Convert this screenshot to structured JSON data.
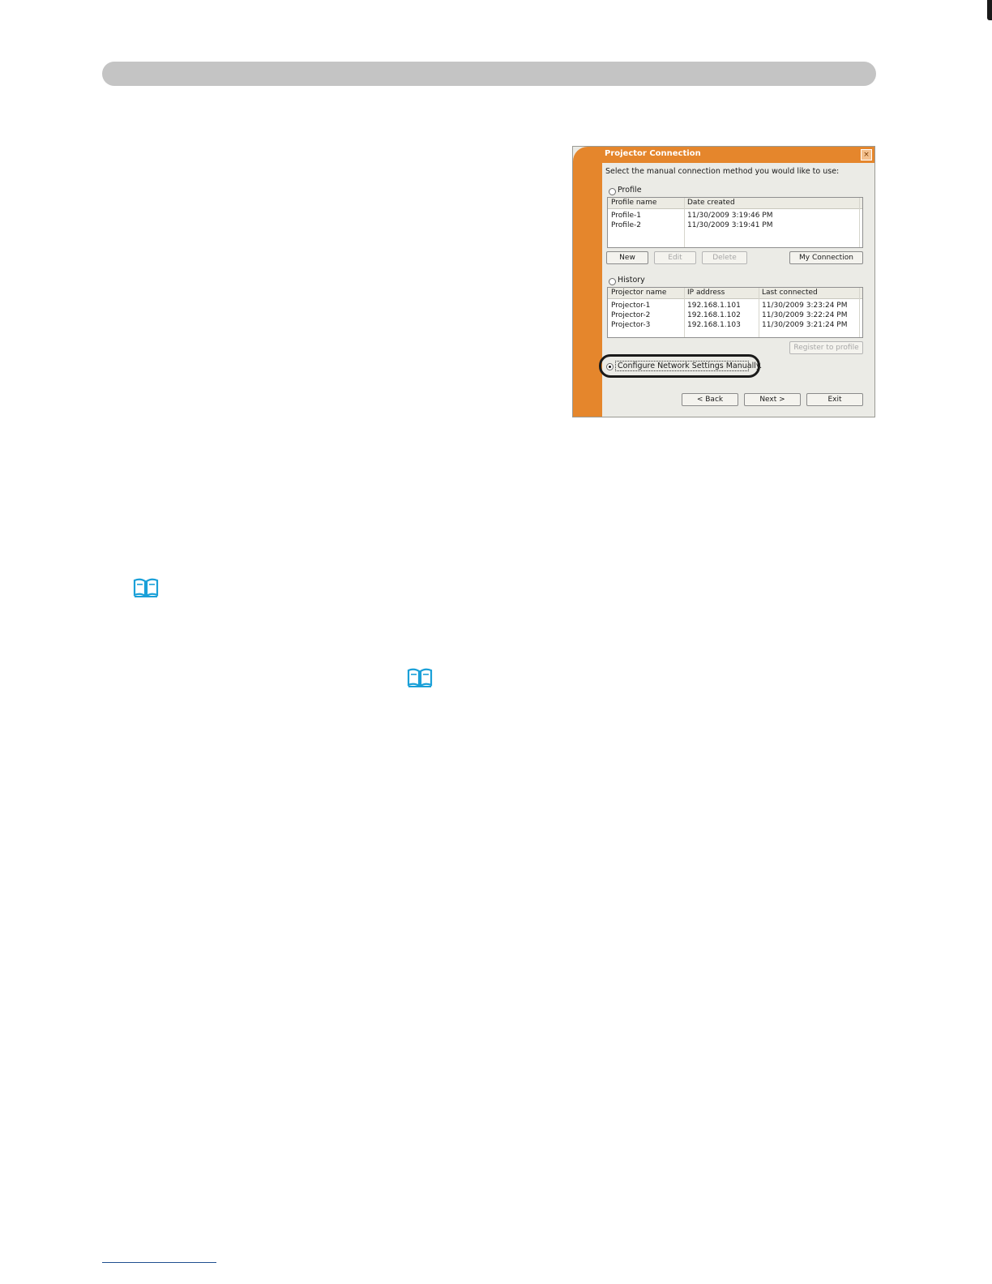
{
  "dialog": {
    "title": "Projector Connection",
    "close_glyph": "×",
    "prompt": "Select the manual connection method you would like to use:",
    "profile": {
      "label": "Profile",
      "columns": [
        "Profile name",
        "Date created"
      ],
      "rows": [
        [
          "Profile-1",
          "11/30/2009 3:19:46 PM"
        ],
        [
          "Profile-2",
          "11/30/2009 3:19:41 PM"
        ]
      ],
      "buttons": {
        "new": "New",
        "edit": "Edit",
        "delete": "Delete",
        "my_connection": "My Connection"
      }
    },
    "history": {
      "label": "History",
      "columns": [
        "Projector name",
        "IP address",
        "Last connected"
      ],
      "rows": [
        [
          "Projector-1",
          "192.168.1.101",
          "11/30/2009 3:23:24 PM"
        ],
        [
          "Projector-2",
          "192.168.1.102",
          "11/30/2009 3:22:24 PM"
        ],
        [
          "Projector-3",
          "192.168.1.103",
          "11/30/2009 3:21:24 PM"
        ]
      ],
      "register_button": "Register to profile"
    },
    "manual_option": "Configure Network Settings Manually.",
    "nav": {
      "back": "< Back",
      "next": "Next >",
      "exit": "Exit"
    },
    "accent_color": "#e5862c"
  },
  "icons": {
    "reference_book_1": "book-icon",
    "reference_book_2": "book-icon"
  }
}
